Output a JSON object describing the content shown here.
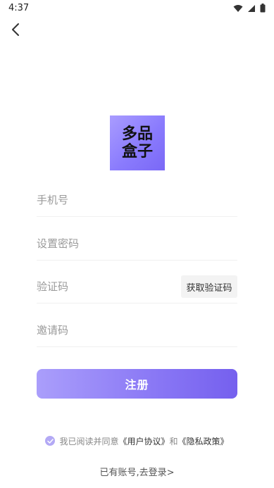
{
  "status_bar": {
    "time": "4:37",
    "icons": [
      "wifi-icon",
      "signal-icon",
      "battery-icon"
    ]
  },
  "nav": {
    "back_icon": "chevron-left-icon"
  },
  "logo": {
    "line1": "多品",
    "line2": "盒子"
  },
  "form": {
    "phone_placeholder": "手机号",
    "password_placeholder": "设置密码",
    "code_placeholder": "验证码",
    "get_code_label": "获取验证码",
    "invite_placeholder": "邀请码"
  },
  "register_button": "注册",
  "agreement": {
    "prefix": "我已阅读并同意",
    "user_agreement": "《用户协议》",
    "and": "和",
    "privacy_policy": "《隐私政策》",
    "checked": true
  },
  "login_link": "已有账号,去登录>",
  "colors": {
    "accent": "#8a7bfd",
    "accent_light": "#aa9efb",
    "check": "#b3a9f5"
  }
}
